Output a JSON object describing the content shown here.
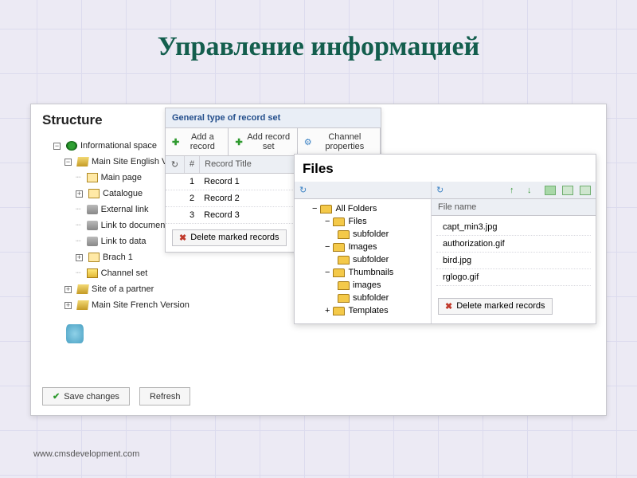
{
  "page_title": "Управление информацией",
  "footer": "www.cmsdevelopment.com",
  "structure": {
    "title": "Structure",
    "tree": {
      "root": "Informational space",
      "mainEn": "Main Site English Ve",
      "mainPage": "Main page",
      "catalogue": "Catalogue",
      "extLink": "External link",
      "linkDoc": "Link to documen",
      "linkData": "Link to data",
      "brach": "Brach 1",
      "channelSet": "Channel set",
      "partner": "Site of a partner",
      "mainFr": "Main Site French Version"
    },
    "buttons": {
      "save": "Save changes",
      "refresh": "Refresh"
    }
  },
  "records": {
    "header": "General type of record set",
    "toolbar": {
      "add": "Add a record",
      "addset": "Add record set",
      "props": "Channel properties"
    },
    "columns": {
      "num": "#",
      "title": "Record Title"
    },
    "rows": [
      {
        "n": "1",
        "t": "Record 1"
      },
      {
        "n": "2",
        "t": "Record 2"
      },
      {
        "n": "3",
        "t": "Record 3"
      }
    ],
    "delete": "Delete marked records"
  },
  "files": {
    "title": "Files",
    "tree": {
      "root": "All Folders",
      "files": "Files",
      "filesSub": "subfolder",
      "images": "Images",
      "imagesSub": "subfolder",
      "thumbs": "Thumbnails",
      "thumbsImg": "images",
      "thumbsSub": "subfolder",
      "templates": "Templates"
    },
    "list": {
      "header": "File name",
      "rows": [
        "capt_min3.jpg",
        "authorization.gif",
        "bird.jpg",
        "rglogo.gif"
      ],
      "delete": "Delete marked records"
    }
  }
}
